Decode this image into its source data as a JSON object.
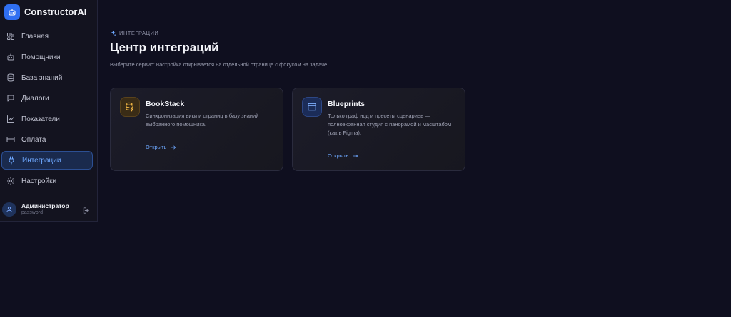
{
  "app": {
    "brand": "ConstructorAI"
  },
  "sidebar": {
    "items": [
      {
        "label": "Главная",
        "icon": "dashboard-icon"
      },
      {
        "label": "Помощники",
        "icon": "bot-icon"
      },
      {
        "label": "База знаний",
        "icon": "database-icon"
      },
      {
        "label": "Диалоги",
        "icon": "chat-icon"
      },
      {
        "label": "Показатели",
        "icon": "chart-icon"
      },
      {
        "label": "Оплата",
        "icon": "card-icon"
      },
      {
        "label": "Интеграции",
        "icon": "plug-icon",
        "active": true
      },
      {
        "label": "Настройки",
        "icon": "gear-icon"
      }
    ],
    "user": {
      "name": "Администратор",
      "sub": "password"
    }
  },
  "main": {
    "eyebrow": "ИНТЕГРАЦИИ",
    "title": "Центр интеграций",
    "subtitle": "Выберите сервис: настройка открывается на отдельной странице с фокусом на задаче.",
    "cards": [
      {
        "title": "BookStack",
        "description": "Синхронизация вики и страниц в базу знаний выбранного помощника.",
        "link": "Открыть",
        "icon": "database-lightning-icon",
        "accent": "#f0b544"
      },
      {
        "title": "Blueprints",
        "description": "Только граф нод и пресеты сценариев — полноэкранная студия с панорамой и масштабом (как в Figma).",
        "link": "Открыть",
        "icon": "window-layout-icon",
        "accent": "#7fb0ff"
      }
    ]
  },
  "colors": {
    "background": "#0f0f1f",
    "accent": "#6ea8ff",
    "brand": "#2f6ff2"
  }
}
